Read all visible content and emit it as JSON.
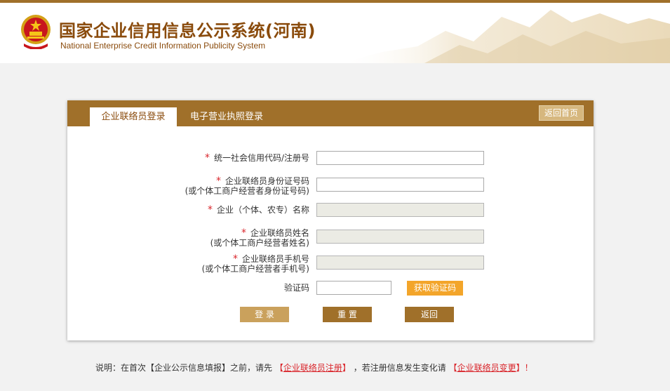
{
  "header": {
    "title_cn": "国家企业信用信息公示系统(河南)",
    "title_en": "National Enterprise Credit Information Publicity System"
  },
  "tabs": [
    {
      "label": "企业联络员登录",
      "active": true
    },
    {
      "label": "电子营业执照登录",
      "active": false
    }
  ],
  "home_button": "返回首页",
  "form": {
    "required_mark": "*",
    "fields": [
      {
        "label": "统一社会信用代码/注册号",
        "sub": "",
        "value": "",
        "disabled": false
      },
      {
        "label": "企业联络员身份证号码",
        "sub": "(或个体工商户经营者身份证号码)",
        "value": "",
        "disabled": false
      },
      {
        "label": "企业（个体、农专）名称",
        "sub": "",
        "value": "",
        "disabled": true
      },
      {
        "label": "企业联络员姓名",
        "sub": "(或个体工商户经营者姓名)",
        "value": "",
        "disabled": true
      },
      {
        "label": "企业联络员手机号",
        "sub": "(或个体工商户经营者手机号)",
        "value": "",
        "disabled": true
      }
    ],
    "captcha_label": "验证码",
    "captcha_value": "",
    "get_code_button": "获取验证码"
  },
  "buttons": {
    "login": "登 录",
    "reset": "重 置",
    "back": "返回"
  },
  "note": {
    "prefix": "说明：在首次【企业公示信息填报】之前，请先",
    "link1_open": "【",
    "link1": "企业联络员注册",
    "link1_close": "】",
    "middle": "，若注册信息发生变化请",
    "link2_open": "【",
    "link2": "企业联络员变更",
    "link2_close": "】！"
  },
  "colors": {
    "brand": "#a0702a",
    "title": "#8a4b0c",
    "required": "#d9262c",
    "accent_button": "#f3a52a"
  }
}
